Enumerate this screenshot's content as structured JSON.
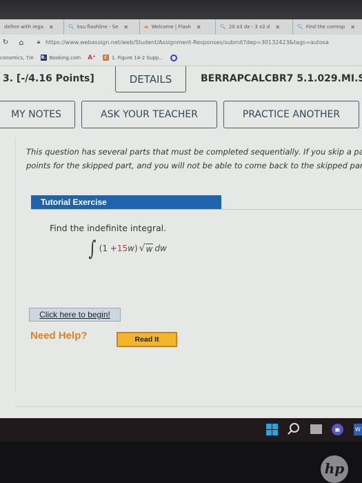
{
  "browser": {
    "tabs": [
      {
        "label": "define with rega",
        "icon": "none"
      },
      {
        "label": "ksu flashline - Se",
        "icon": "search-icon"
      },
      {
        "label": "Welcome | Flash",
        "icon": "flashline-icon"
      },
      {
        "label": "20 x3 dx - 3 x2 d",
        "icon": "search-icon"
      },
      {
        "label": "Find the corresp",
        "icon": "search-icon"
      }
    ],
    "tab_close_glyph": "✕",
    "url": "https://www.webassign.net/web/Student/Assignment-Responses/submit?dep=30132423&tags=autosa",
    "bookmarks": [
      {
        "label": "conomics, 7/e",
        "icon": "none"
      },
      {
        "label": "Booking.com",
        "icon": "booking-icon",
        "icon_text": "B."
      },
      {
        "label": "",
        "icon": "text-size-icon",
        "icon_text": "A⁺"
      },
      {
        "label": "1. Figure 14-2 Supp...",
        "icon": "chegg-icon",
        "icon_text": "C"
      },
      {
        "label": "",
        "icon": "quizlet-icon"
      }
    ]
  },
  "question": {
    "number": "3.  [-/4.16 Points]",
    "details_label": "DETAILS",
    "code": "BERRAPCALCBR7 5.1.029.MI.S",
    "buttons": {
      "my_notes": "MY NOTES",
      "ask_teacher": "ASK YOUR TEACHER",
      "practice_another": "PRACTICE ANOTHER"
    },
    "notice_line1": "This question has several parts that must be completed sequentially. If you skip a part of the question, you will not receive any",
    "notice_line2": "points for the skipped part, and you will not be able to come back to the skipped part.",
    "tutorial_title": "Tutorial Exercise",
    "prompt": "Find the indefinite integral.",
    "formula": {
      "integral_sign": "∫",
      "open": "(1 + ",
      "highlight": "15",
      "var_w": "w",
      "close": ")",
      "radical": "√",
      "radicand": "w",
      "differential": " dw"
    },
    "begin_label": "Click here to begin!",
    "need_help": "Need Help?",
    "read_it": "Read It"
  },
  "taskbar": {
    "teams_glyph": "▣",
    "word_glyph": "W"
  },
  "device_logo": "hp",
  "colors": {
    "tutorial_bar": "#1f63ad",
    "need_help": "#d8822a",
    "read_it_bg": "#f2b52c",
    "formula_highlight": "#d03030"
  }
}
